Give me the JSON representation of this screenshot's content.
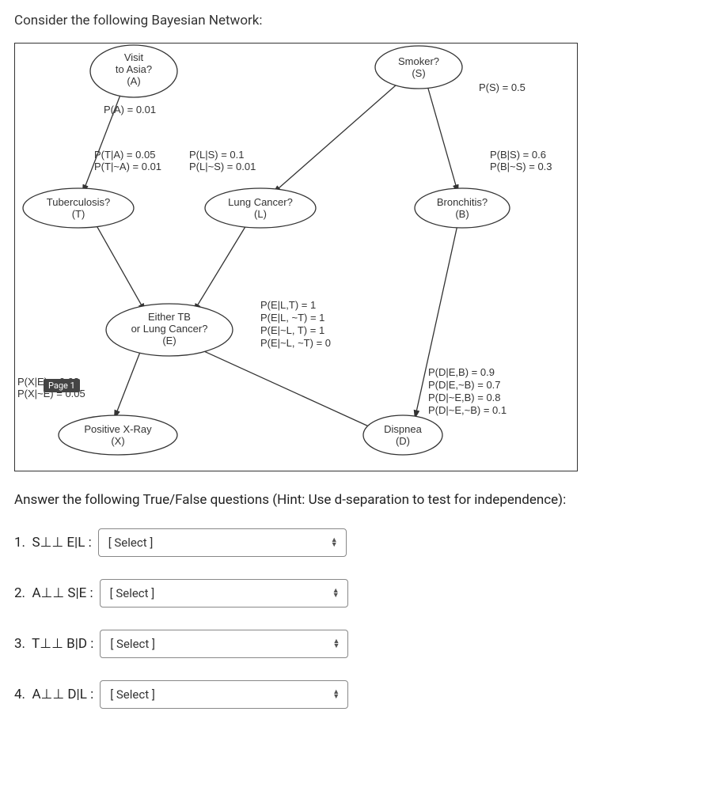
{
  "prompt": "Consider the following Bayesian Network:",
  "answer_prompt": "Answer the following True/False questions (Hint: Use d-separation to test for independence):",
  "page_marker": "Page 1",
  "nodes": {
    "A": {
      "title": "Visit",
      "sub": "to Asia?",
      "var": "(A)"
    },
    "S": {
      "title": "Smoker?",
      "var": "(S)"
    },
    "T": {
      "title": "Tuberculosis?",
      "var": "(T)"
    },
    "L": {
      "title": "Lung Cancer?",
      "var": "(L)"
    },
    "B": {
      "title": "Bronchitis?",
      "var": "(B)"
    },
    "E": {
      "title": "Either TB",
      "sub": "or Lung Cancer?",
      "var": "(E)"
    },
    "X": {
      "title": "Positive X-Ray",
      "var": "(X)"
    },
    "D": {
      "title": "Dispnea",
      "var": "(D)"
    }
  },
  "cpt": {
    "A": "P(A) = 0.01",
    "S": "P(S) = 0.5",
    "T1": "P(T|A) = 0.05",
    "T2": "P(T|~A) = 0.01",
    "L1": "P(L|S) = 0.1",
    "L2": "P(L|~S) = 0.01",
    "B1": "P(B|S) = 0.6",
    "B2": "P(B|~S) = 0.3",
    "E1": "P(E|L,T) = 1",
    "E2": "P(E|L, ~T) = 1",
    "E3": "P(E|~L, T) = 1",
    "E4": "P(E|~L, ~T) = 0",
    "X1": "P(X|E) = 0.98",
    "X2": "P(X|~E) = 0.05",
    "D1": "P(D|E,B) = 0.9",
    "D2": "P(D|E,~B) = 0.7",
    "D3": "P(D|~E,B) = 0.8",
    "D4": "P(D|~E,~B) = 0.1"
  },
  "questions": {
    "q1": "1.  S⊥⊥ E|L :",
    "q2": "2.  A⊥⊥ S|E :",
    "q3": "3.  T⊥⊥ B|D :",
    "q4": "4.  A⊥⊥ D|L :"
  },
  "select_placeholder": "[ Select ]"
}
